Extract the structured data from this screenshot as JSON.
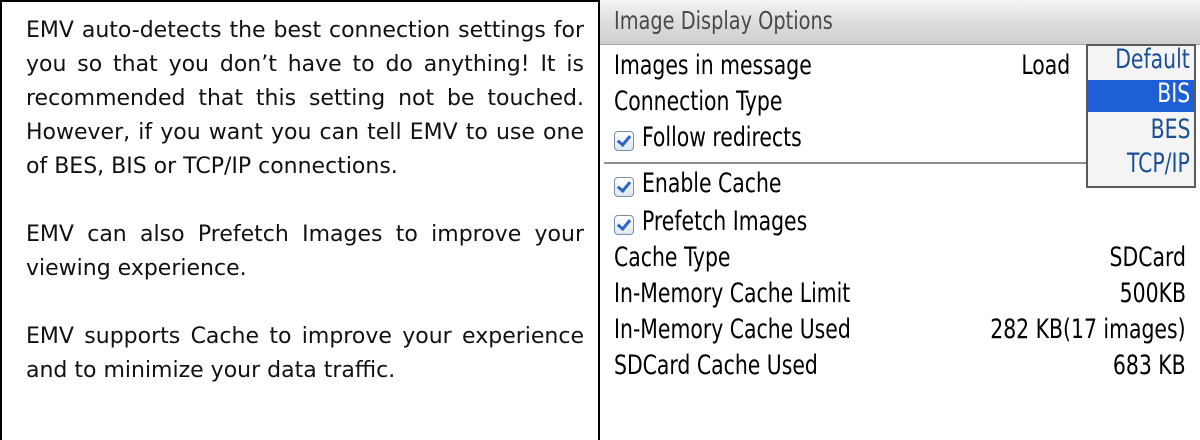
{
  "description": {
    "paragraphs": [
      "EMV auto-detects the best connection settings for you so that you don’t have to do anything! It is recommended that this setting not be touched. However, if you want you can tell EMV to use one of BES, BIS or TCP/IP connections.",
      "EMV can also Prefetch Images to improve your viewing experience.",
      "EMV supports Cache to improve your experience and to minimize your data traffic."
    ]
  },
  "screen": {
    "title": "Image Display Options",
    "images_in_message": {
      "label": "Images in message",
      "value": "Load"
    },
    "connection_type": {
      "label": "Connection Type"
    },
    "follow_redirects": {
      "label": "Follow redirects",
      "checked": true
    },
    "enable_cache": {
      "label": "Enable Cache",
      "checked": true
    },
    "prefetch_images": {
      "label": "Prefetch Images",
      "checked": true
    },
    "cache_type": {
      "label": "Cache Type",
      "value": "SDCard"
    },
    "in_memory_cache_limit": {
      "label": "In-Memory Cache Limit",
      "value": "500KB"
    },
    "in_memory_cache_used": {
      "label": "In-Memory Cache Used",
      "value": "282 KB(17 images)"
    },
    "sdcard_cache_used": {
      "label": "SDCard Cache Used",
      "value": "683 KB"
    }
  },
  "connection_dropdown": {
    "options": [
      "Default",
      "BIS",
      "BES",
      "TCP/IP"
    ],
    "selected": "BIS"
  },
  "colors": {
    "selection": "#1f5fd6",
    "option_text": "#1a4f96",
    "checkmark": "#2c66c6"
  }
}
